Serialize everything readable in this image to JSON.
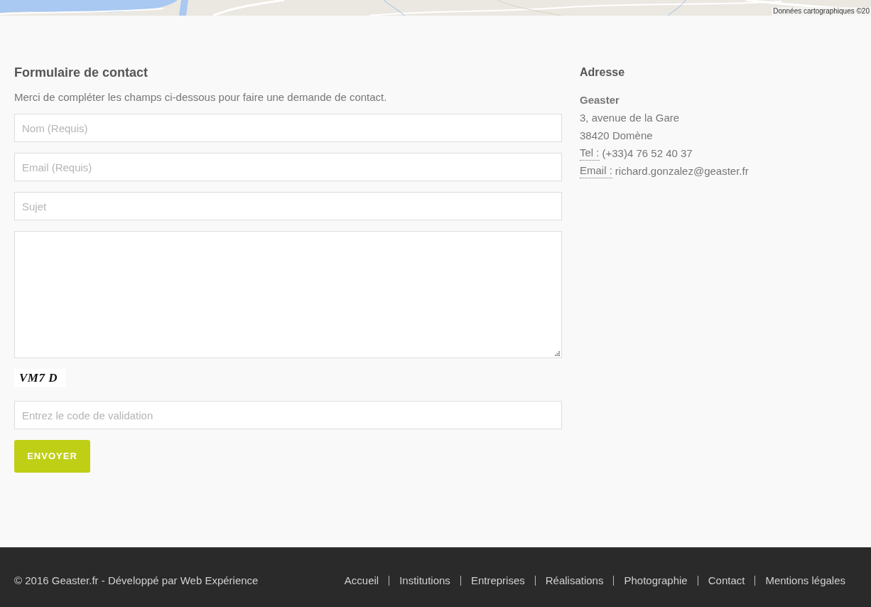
{
  "map": {
    "attribution": "Données cartographiques ©20"
  },
  "contact_form": {
    "title": "Formulaire de contact",
    "intro": "Merci de compléter les champs ci-dessous pour faire une demande de contact.",
    "fields": [
      {
        "kind": "input",
        "placeholder": "Nom (Requis)"
      },
      {
        "kind": "input",
        "placeholder": "Email (Requis)"
      },
      {
        "kind": "input",
        "placeholder": "Sujet"
      },
      {
        "kind": "textarea"
      }
    ],
    "captcha": {
      "code": "VM7 D"
    },
    "validation_field": {
      "placeholder": "Entrez le code de validation"
    },
    "submit_button": "ENVOYER"
  },
  "address": {
    "title": "Adresse",
    "company": "Geaster",
    "lines": [
      "3, avenue de la Gare",
      "38420 Domène"
    ],
    "contacts": [
      {
        "label": "Tel :",
        "value": "(+33)4 76 52 40 37"
      },
      {
        "label": "Email :",
        "value": "richard.gonzalez@geaster.fr"
      }
    ]
  },
  "footer": {
    "copyright": "© 2016 Geaster.fr - Développé par Web Expérience",
    "links": [
      "Accueil",
      "Institutions",
      "Entreprises",
      "Réalisations",
      "Photographie",
      "Contact",
      "Mentions légales"
    ]
  }
}
